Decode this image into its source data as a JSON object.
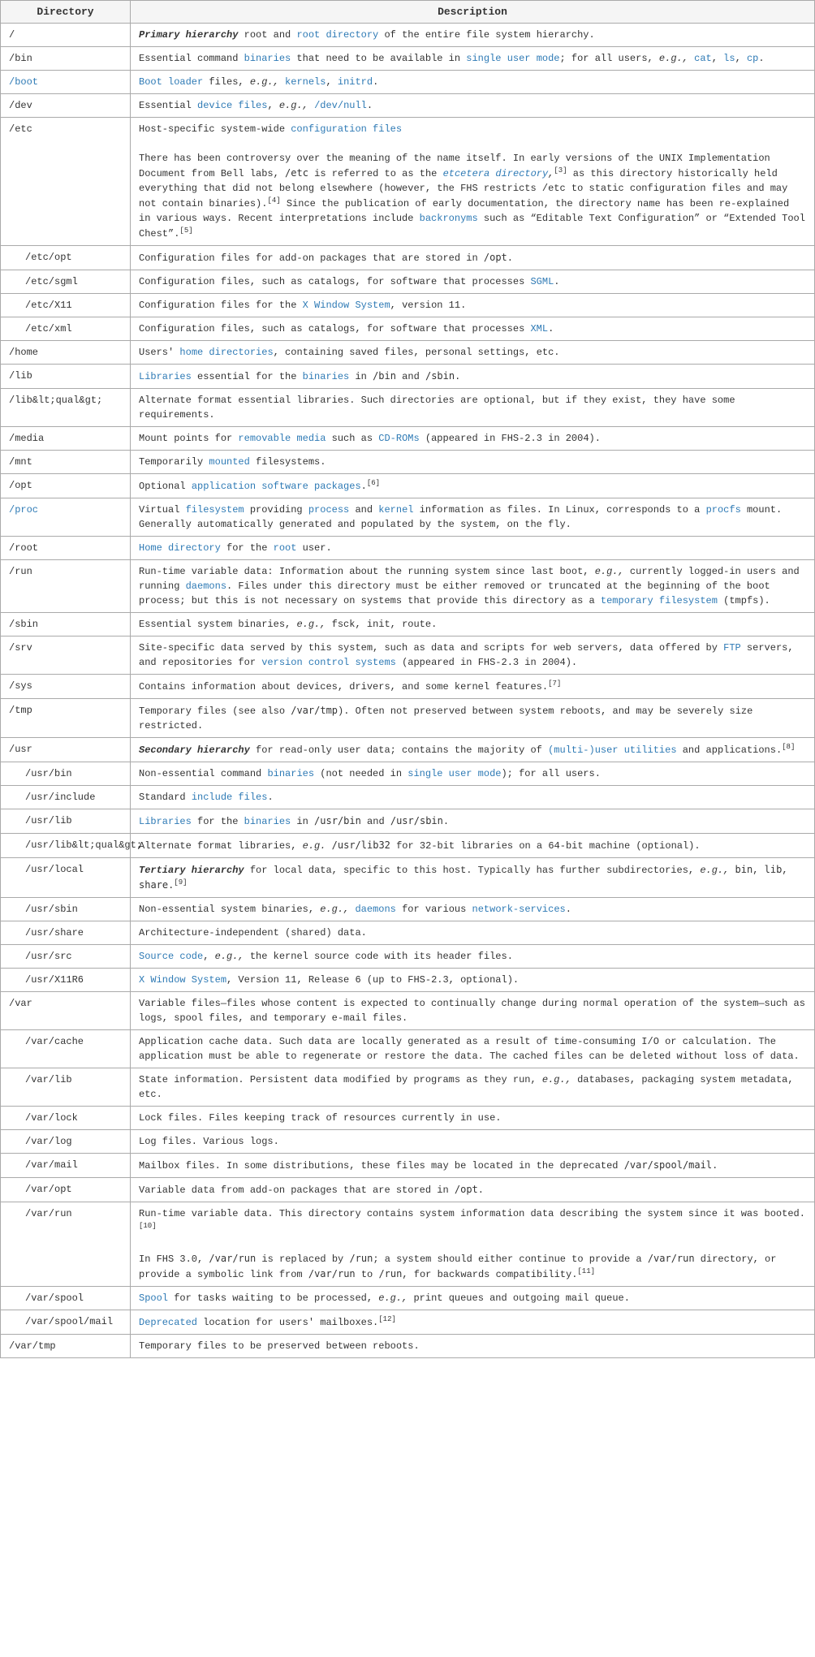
{
  "table": {
    "headers": [
      "Directory",
      "Description"
    ],
    "rows": [
      {
        "dir": "/",
        "dir_color": "black",
        "dir_indent": false,
        "desc_html": "<span class='italic bold'>Primary hierarchy</span> root and <a class='link'>root directory</a> of the entire file system hierarchy."
      },
      {
        "dir": "/bin",
        "dir_color": "black",
        "dir_indent": false,
        "desc_html": "Essential command <a class='link'>binaries</a> that need to be available in <a class='link'>single user mode</a>; for all users, <span class='italic'>e.g.,</span> <a class='link'>cat</a>, <a class='link'>ls</a>, <a class='link'>cp</a>."
      },
      {
        "dir": "/boot",
        "dir_color": "blue",
        "dir_indent": false,
        "desc_html": "<a class='link'>Boot loader</a> files, <span class='italic'>e.g.,</span> <a class='link'>kernels</a>, <a class='link'>initrd</a>."
      },
      {
        "dir": "/dev",
        "dir_color": "black",
        "dir_indent": false,
        "desc_html": "Essential <a class='link'>device files</a>, <span class='italic'>e.g.,</span> <a class='link'>/dev/null</a>."
      },
      {
        "dir": "/etc",
        "dir_color": "black",
        "dir_indent": false,
        "desc_html": "Host-specific system-wide <a class='link'>configuration files</a><br><br>There has been controversy over the meaning of the name itself. In early versions of the UNIX Implementation Document from Bell labs, <code>/etc</code> is referred to as the <span class='italic'><a class='link'>etcetera directory</a>,</span><span class='sup'>[3]</span> as this directory historically held everything that did not belong elsewhere (however, the FHS restricts /etc to static configuration files and may not contain binaries).<span class='sup'>[4]</span> Since the publication of early documentation, the directory name has been re-explained in various ways. Recent interpretations include <a class='link'>backronyms</a> such as &ldquo;Editable Text Configuration&rdquo; or &ldquo;Extended Tool Chest&rdquo;.<span class='sup'>[5]</span>"
      },
      {
        "dir": "/etc/opt",
        "dir_color": "black",
        "dir_indent": true,
        "desc_html": "Configuration files for add-on packages that are stored in <code>/opt</code>."
      },
      {
        "dir": "/etc/sgml",
        "dir_color": "black",
        "dir_indent": true,
        "desc_html": "Configuration files, such as catalogs, for software that processes <a class='link'>SGML</a>."
      },
      {
        "dir": "/etc/X11",
        "dir_color": "black",
        "dir_indent": true,
        "desc_html": "Configuration files for the <a class='link'>X Window System</a>, version 11."
      },
      {
        "dir": "/etc/xml",
        "dir_color": "black",
        "dir_indent": true,
        "desc_html": "Configuration files, such as catalogs, for software that processes <a class='link'>XML</a>."
      },
      {
        "dir": "/home",
        "dir_color": "black",
        "dir_indent": false,
        "desc_html": "Users' <a class='link'>home directories</a>, containing saved files, personal settings, etc."
      },
      {
        "dir": "/lib",
        "dir_color": "black",
        "dir_indent": false,
        "desc_html": "<a class='link'>Libraries</a> essential for the <a class='link'>binaries</a> in <code>/bin</code> and <code>/sbin</code>."
      },
      {
        "dir": "/lib&lt;qual&gt;",
        "dir_color": "black",
        "dir_indent": false,
        "desc_html": "Alternate format essential libraries. Such directories are optional, but if they exist, they have some requirements."
      },
      {
        "dir": "/media",
        "dir_color": "black",
        "dir_indent": false,
        "desc_html": "Mount points for <a class='link'>removable media</a> such as <a class='link'>CD-ROMs</a> (appeared in FHS-2.3 in 2004)."
      },
      {
        "dir": "/mnt",
        "dir_color": "black",
        "dir_indent": false,
        "desc_html": "Temporarily <a class='link'>mounted</a> filesystems."
      },
      {
        "dir": "/opt",
        "dir_color": "black",
        "dir_indent": false,
        "desc_html": "Optional <a class='link'>application software packages</a>.<span class='sup'>[6]</span>"
      },
      {
        "dir": "/proc",
        "dir_color": "blue",
        "dir_indent": false,
        "desc_html": "Virtual <a class='link'>filesystem</a> providing <a class='link'>process</a> and <a class='link'>kernel</a> information as files. In Linux, corresponds to a <a class='link'>procfs</a> mount. Generally automatically generated and populated by the system, on the fly."
      },
      {
        "dir": "/root",
        "dir_color": "black",
        "dir_indent": false,
        "desc_html": "<a class='link'>Home directory</a> for the <a class='link'>root</a> user."
      },
      {
        "dir": "/run",
        "dir_color": "black",
        "dir_indent": false,
        "desc_html": "Run-time variable data: Information about the running system since last boot, <span class='italic'>e.g.,</span> currently logged-in users and running <a class='link'>daemons</a>. Files under this directory must be either removed or truncated at the beginning of the boot process; but this is not necessary on systems that provide this directory as a <a class='link'>temporary filesystem</a> (tmpfs)."
      },
      {
        "dir": "/sbin",
        "dir_color": "black",
        "dir_indent": false,
        "desc_html": "Essential system binaries, <span class='italic'>e.g.,</span> fsck, init, route."
      },
      {
        "dir": "/srv",
        "dir_color": "black",
        "dir_indent": false,
        "desc_html": "Site-specific data served by this system, such as data and scripts for web servers, data offered by <a class='link'>FTP</a> servers, and repositories for <a class='link'>version control systems</a> (appeared in FHS-2.3 in 2004)."
      },
      {
        "dir": "/sys",
        "dir_color": "black",
        "dir_indent": false,
        "desc_html": "Contains information about devices, drivers, and some kernel features.<span class='sup'>[7]</span>"
      },
      {
        "dir": "/tmp",
        "dir_color": "black",
        "dir_indent": false,
        "desc_html": "Temporary files (see also <code>/var/tmp</code>). Often not preserved between system reboots, and may be severely size restricted."
      },
      {
        "dir": "/usr",
        "dir_color": "black",
        "dir_indent": false,
        "desc_html": "<span class='italic bold'>Secondary hierarchy</span> for read-only user data; contains the majority of <a class='link'>(multi-)user utilities</a> and applications.<span class='sup'>[8]</span>"
      },
      {
        "dir": "/usr/bin",
        "dir_color": "black",
        "dir_indent": true,
        "desc_html": "Non-essential command <a class='link'>binaries</a> (not needed in <a class='link'>single user mode</a>); for all users."
      },
      {
        "dir": "/usr/include",
        "dir_color": "black",
        "dir_indent": true,
        "desc_html": "Standard <a class='link'>include files</a>."
      },
      {
        "dir": "/usr/lib",
        "dir_color": "black",
        "dir_indent": true,
        "desc_html": "<a class='link'>Libraries</a> for the <a class='link'>binaries</a> in <code>/usr/bin</code> and <code>/usr/sbin</code>."
      },
      {
        "dir": "/usr/lib&lt;qual&gt;",
        "dir_color": "black",
        "dir_indent": true,
        "desc_html": "Alternate format libraries, <span class='italic'>e.g.</span> <code>/usr/lib32</code> for 32-bit libraries on a 64-bit machine (optional)."
      },
      {
        "dir": "/usr/local",
        "dir_color": "black",
        "dir_indent": true,
        "desc_html": "<span class='italic bold'>Tertiary hierarchy</span> for local data, specific to this host. Typically has further subdirectories, <span class='italic'>e.g.,</span> <code>bin</code>, <code>lib</code>, <code>share</code>.<span class='sup'>[9]</span>"
      },
      {
        "dir": "/usr/sbin",
        "dir_color": "black",
        "dir_indent": true,
        "desc_html": "Non-essential system binaries, <span class='italic'>e.g.,</span> <a class='link'>daemons</a> for various <a class='link'>network-services</a>."
      },
      {
        "dir": "/usr/share",
        "dir_color": "black",
        "dir_indent": true,
        "desc_html": "Architecture-independent (shared) data."
      },
      {
        "dir": "/usr/src",
        "dir_color": "black",
        "dir_indent": true,
        "desc_html": "<a class='link'>Source code</a>, <span class='italic'>e.g.,</span> the kernel source code with its header files."
      },
      {
        "dir": "/usr/X11R6",
        "dir_color": "black",
        "dir_indent": true,
        "desc_html": "<a class='link'>X Window System</a>, Version 11, Release 6 (up to FHS-2.3, optional)."
      },
      {
        "dir": "/var",
        "dir_color": "black",
        "dir_indent": false,
        "desc_html": "Variable files&mdash;files whose content is expected to continually change during normal operation of the system&mdash;such as logs, spool files, and temporary e-mail files."
      },
      {
        "dir": "/var/cache",
        "dir_color": "black",
        "dir_indent": true,
        "desc_html": "Application cache data. Such data are locally generated as a result of time-consuming I/O or calculation. The application must be able to regenerate or restore the data. The cached files can be deleted without loss of data."
      },
      {
        "dir": "/var/lib",
        "dir_color": "black",
        "dir_indent": true,
        "desc_html": "State information. Persistent data modified by programs as they run, <span class='italic'>e.g.,</span> databases, packaging system metadata, etc."
      },
      {
        "dir": "/var/lock",
        "dir_color": "black",
        "dir_indent": true,
        "desc_html": "Lock files. Files keeping track of resources currently in use."
      },
      {
        "dir": "/var/log",
        "dir_color": "black",
        "dir_indent": true,
        "desc_html": "Log files. Various logs."
      },
      {
        "dir": "/var/mail",
        "dir_color": "black",
        "dir_indent": true,
        "desc_html": "Mailbox files. In some distributions, these files may be located in the deprecated <code>/var/spool/mail</code>."
      },
      {
        "dir": "/var/opt",
        "dir_color": "black",
        "dir_indent": true,
        "desc_html": "Variable data from add-on packages that are stored in <code>/opt</code>."
      },
      {
        "dir": "/var/run",
        "dir_color": "black",
        "dir_indent": true,
        "desc_html": "Run-time variable data. This directory contains system information data describing the system since it was booted.<span class='sup'>[10]</span><br><br>In FHS 3.0, <code>/var/run</code> is replaced by <code>/run</code>; a system should either continue to provide a <code>/var/run</code> directory, or provide a symbolic link from <code>/var/run</code> to <code>/run</code>, for backwards compatibility.<span class='sup'>[11]</span>"
      },
      {
        "dir": "/var/spool",
        "dir_color": "black",
        "dir_indent": true,
        "desc_html": "<a class='link'>Spool</a> for tasks waiting to be processed, <span class='italic'>e.g.,</span> print queues and outgoing mail queue."
      },
      {
        "dir": "/var/spool/mail",
        "dir_color": "black",
        "dir_indent": true,
        "desc_html": "<a class='link'>Deprecated</a> location for users' mailboxes.<span class='sup'>[12]</span>"
      },
      {
        "dir": "/var/tmp",
        "dir_color": "black",
        "dir_indent": false,
        "desc_html": "Temporary files to be preserved between reboots."
      }
    ]
  }
}
